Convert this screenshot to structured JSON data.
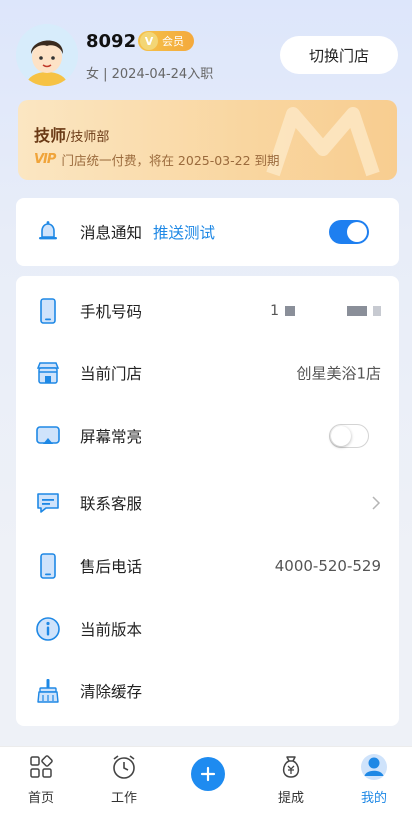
{
  "profile": {
    "name": "8092",
    "badge_letter": "V",
    "badge_label": "会员",
    "meta": "女 | 2024-04-24入职",
    "switch_store_label": "切换门店"
  },
  "vip": {
    "role": "技师",
    "dept": "/技师部",
    "logo_text": "VIP",
    "desc": "门店统一付费，将在 2025-03-22 到期"
  },
  "notification": {
    "label": "消息通知",
    "push_test": "推送测试",
    "enabled": true
  },
  "settings": [
    {
      "key": "phone",
      "label": "手机号码",
      "value": "1",
      "icon": "phone-icon"
    },
    {
      "key": "store",
      "label": "当前门店",
      "value": "创星美浴1店",
      "icon": "store-icon"
    },
    {
      "key": "screen",
      "label": "屏幕常亮",
      "toggle": false,
      "icon": "screen-icon"
    },
    {
      "key": "service",
      "label": "联系客服",
      "icon": "chat-icon"
    },
    {
      "key": "aftersale",
      "label": "售后电话",
      "value": "4000-520-529",
      "icon": "phone-icon"
    },
    {
      "key": "version",
      "label": "当前版本",
      "icon": "info-icon"
    },
    {
      "key": "cache",
      "label": "清除缓存",
      "icon": "broom-icon"
    }
  ],
  "tabbar": {
    "home": "首页",
    "work": "工作",
    "withdraw": "提成",
    "mine": "我的",
    "active": "mine"
  },
  "colors": {
    "accent": "#1e88e5",
    "vip_gold": "#f0a43a",
    "vip_text": "#6b3a16"
  }
}
